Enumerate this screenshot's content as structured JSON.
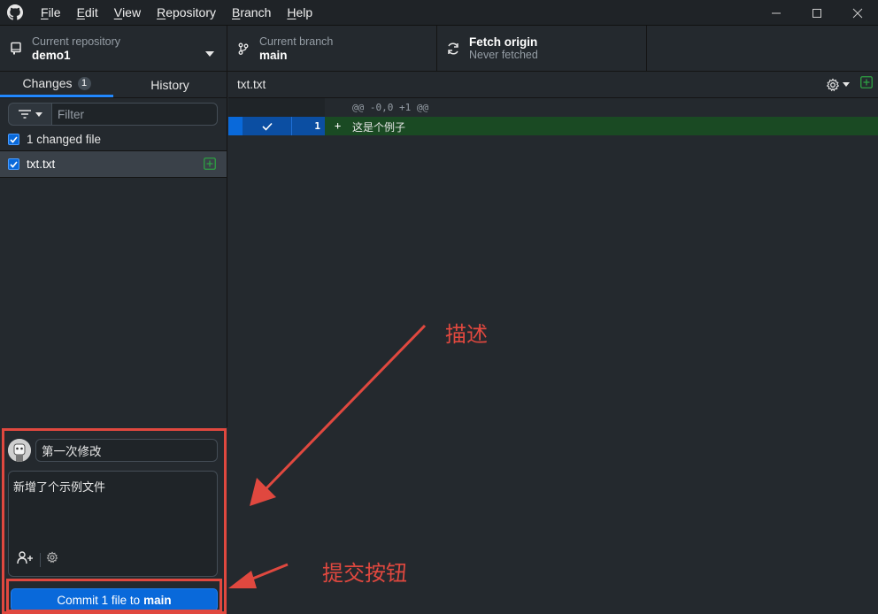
{
  "menu": {
    "items": [
      {
        "label": "File",
        "u": "F",
        "rest": "ile"
      },
      {
        "label": "Edit",
        "u": "E",
        "rest": "dit"
      },
      {
        "label": "View",
        "u": "V",
        "rest": "iew"
      },
      {
        "label": "Repository",
        "u": "R",
        "rest": "epository"
      },
      {
        "label": "Branch",
        "u": "B",
        "rest": "ranch"
      },
      {
        "label": "Help",
        "u": "H",
        "rest": "elp"
      }
    ]
  },
  "toolbar": {
    "repo_caption": "Current repository",
    "repo_name": "demo1",
    "branch_caption": "Current branch",
    "branch_name": "main",
    "fetch_title": "Fetch origin",
    "fetch_status": "Never fetched"
  },
  "sidebar": {
    "tab_changes": "Changes",
    "changes_count": "1",
    "tab_history": "History",
    "filter_placeholder": "Filter",
    "changed_files_label": "1 changed file",
    "files": [
      {
        "name": "txt.txt",
        "status": "added"
      }
    ]
  },
  "commit": {
    "summary": "第一次修改",
    "description": "新增了个示例文件",
    "button_prefix": "Commit 1 file to",
    "button_branch": "main"
  },
  "diff": {
    "file_title": "txt.txt",
    "hunk_header": "@@ -0,0 +1 @@",
    "lines": [
      {
        "number": "1",
        "marker": "+",
        "text": "这是个例子"
      }
    ]
  },
  "annotations": {
    "description_label": "描述",
    "commit_button_label": "提交按钮",
    "color": "#e0483f"
  },
  "colors": {
    "accent": "#0969da",
    "added_row": "#1a4a23",
    "added_icon": "#2ea043"
  }
}
